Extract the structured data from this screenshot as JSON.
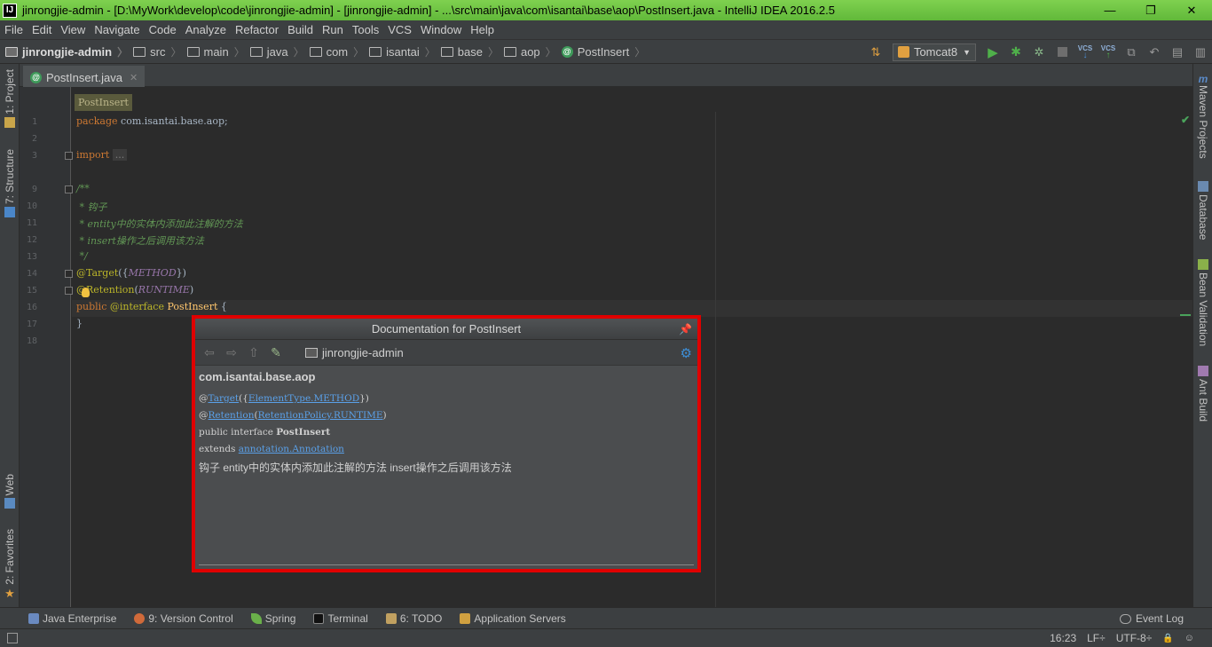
{
  "window": {
    "title": "jinrongjie-admin - [D:\\MyWork\\develop\\code\\jinrongjie-admin] - [jinrongjie-admin] - ...\\src\\main\\java\\com\\isantai\\base\\aop\\PostInsert.java - IntelliJ IDEA 2016.2.5",
    "logo": "IJ",
    "minimize": "—",
    "restore": "❐",
    "close": "✕"
  },
  "menu": [
    "File",
    "Edit",
    "View",
    "Navigate",
    "Code",
    "Analyze",
    "Refactor",
    "Build",
    "Run",
    "Tools",
    "VCS",
    "Window",
    "Help"
  ],
  "breadcrumbs": [
    "jinrongjie-admin",
    "src",
    "main",
    "java",
    "com",
    "isantai",
    "base",
    "aop",
    "PostInsert"
  ],
  "toolbar": {
    "run_config": "Tomcat8",
    "vcs1": "VCS",
    "vcs2": "VCS"
  },
  "left_tools": {
    "project": "1: Project",
    "structure": "7: Structure",
    "web": "Web",
    "favorites": "2: Favorites"
  },
  "right_tools": {
    "maven": "Maven Projects",
    "database": "Database",
    "bean_validation": "Bean Validation",
    "ant_build": "Ant Build"
  },
  "editor": {
    "tab": "PostInsert.java",
    "structure_hint": "PostInsert",
    "line_numbers": [
      "1",
      "2",
      "3",
      "9",
      "10",
      "11",
      "12",
      "13",
      "14",
      "15",
      "16",
      "17",
      "18"
    ],
    "code": {
      "l1_kw": "package",
      "l1_rest": " com.isantai.base.aop;",
      "l3_kw": "import",
      "l3_fold": "...",
      "l9": "/**",
      "l10": " * 钩子",
      "l11": " * entity中的实体内添加此注解的方法",
      "l12": " * insert操作之后调用该方法",
      "l13": " */",
      "l14_an": "@Target",
      "l14_a": "({",
      "l14_c": "METHOD",
      "l14_b": "})",
      "l15_an": "@Retention",
      "l15_a": "(",
      "l15_c": "RUNTIME",
      "l15_b": ")",
      "l16_kw": "public",
      "l16_an": " @interface",
      "l16_sp": " ",
      "l16_tp": "PostInsert",
      "l16_rest": " {",
      "l17": "}"
    }
  },
  "doc_popup": {
    "title": "Documentation for PostInsert",
    "module": "jinrongjie-admin",
    "package": "com.isantai.base.aop",
    "line1_at": "@",
    "line1_link": "Target",
    "line1_mid": "({",
    "line1_link2": "ElementType.METHOD",
    "line1_end": "})",
    "line2_at": "@",
    "line2_link": "Retention",
    "line2_mid": "(",
    "line2_link2": "RetentionPolicy.RUNTIME",
    "line2_end": ")",
    "line3_plain": "public interface ",
    "line3_bold": "PostInsert",
    "line4_plain": "extends ",
    "line4_link": "annotation.Annotation",
    "description": "钩子  entity中的实体内添加此注解的方法  insert操作之后调用该方法"
  },
  "bottom_tools": {
    "java_enterprise": "Java Enterprise",
    "version_control": "9: Version Control",
    "spring": "Spring",
    "terminal": "Terminal",
    "todo": "6: TODO",
    "app_servers": "Application Servers",
    "event_log": "Event Log"
  },
  "status": {
    "position": "16:23",
    "line_sep": "LF÷",
    "encoding": "UTF-8÷"
  },
  "colors": {
    "title_bar": "#6cc644",
    "highlight_border": "#e00000",
    "keyword": "#cc7832",
    "comment": "#629755",
    "annotation": "#bbb529"
  }
}
